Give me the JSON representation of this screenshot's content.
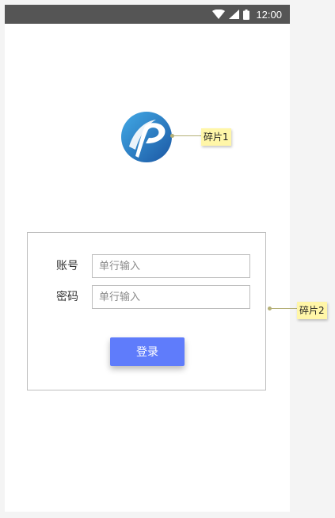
{
  "status_bar": {
    "time": "12:00",
    "icons": [
      "wifi-icon",
      "cell-signal-icon",
      "battery-icon"
    ]
  },
  "logo": {
    "icon": "p-logo-icon",
    "gradient_start": "#3aa0e0",
    "gradient_end": "#1d5fa8"
  },
  "login_form": {
    "account_label": "账号",
    "account_placeholder": "单行输入",
    "password_label": "密码",
    "password_placeholder": "单行输入",
    "submit_label": "登录",
    "accent_color": "#5f7cfb"
  },
  "annotations": [
    {
      "label": "碎片1"
    },
    {
      "label": "碎片2"
    }
  ]
}
